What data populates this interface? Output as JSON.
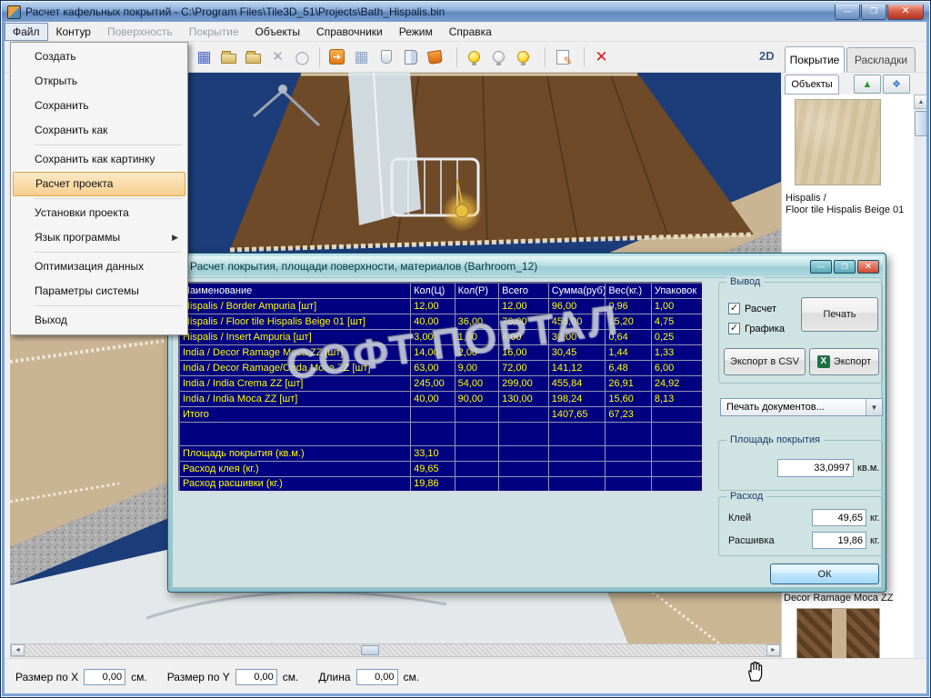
{
  "window": {
    "title": "Расчет кафельных покрытий - C:\\Program Files\\Tile3D_51\\Projects\\Bath_Hispalis.bin"
  },
  "menubar": {
    "file": "Файл",
    "contour": "Контур",
    "surface": "Поверхность",
    "covering": "Покрытие",
    "objects": "Объекты",
    "catalogs": "Справочники",
    "mode": "Режим",
    "help": "Справка"
  },
  "file_menu": {
    "new": "Создать",
    "open": "Открыть",
    "save": "Сохранить",
    "save_as": "Сохранить как",
    "save_as_picture": "Сохранить как картинку",
    "project_calc": "Расчет проекта",
    "project_settings": "Установки проекта",
    "language": "Язык программы",
    "data_optimization": "Оптимизация данных",
    "system_params": "Параметры системы",
    "exit": "Выход"
  },
  "toolbar": {
    "label_2d": "2D"
  },
  "right_panel": {
    "tab_covering": "Покрытие",
    "tab_layouts": "Раскладки",
    "tab_objects": "Объекты",
    "thumb1_line1": "Hispalis /",
    "thumb1_line2": "Floor tile Hispalis Beige 01",
    "thumb2_label": "Decor Ramage Moca ZZ"
  },
  "dialog": {
    "title": "Расчет покрытия, площади поверхности, материалов (Barhroom_12)",
    "table": {
      "headers": [
        "Наименование",
        "Кол(Ц)",
        "Кол(Р)",
        "Всего",
        "Сумма(руб)",
        "Вес(кг.)",
        "Упаковок"
      ],
      "rows": [
        [
          "Hispalis / Border Ampuria [шт]",
          "12,00",
          "",
          "12,00",
          "96,00",
          "0,96",
          "1,00"
        ],
        [
          "Hispalis / Floor tile Hispalis Beige 01 [шт]",
          "40,00",
          "36,00",
          "76,00",
          "456,00",
          "15,20",
          "4,75"
        ],
        [
          "Hispalis / Insert Ampuria [шт]",
          "3,00",
          "1,00",
          "4,00",
          "30,00",
          "0,64",
          "0,25"
        ],
        [
          "India / Decor Ramage Moca ZZ [шт]",
          "14,00",
          "2,00",
          "16,00",
          "30,45",
          "1,44",
          "1,33"
        ],
        [
          "India / Decor Ramage/Onda Moca ZZ [шт]",
          "63,00",
          "9,00",
          "72,00",
          "141,12",
          "6,48",
          "6,00"
        ],
        [
          "India / India Crema ZZ [шт]",
          "245,00",
          "54,00",
          "299,00",
          "455,84",
          "26,91",
          "24,92"
        ],
        [
          "India / India Moca ZZ [шт]",
          "40,00",
          "90,00",
          "130,00",
          "198,24",
          "15,60",
          "8,13"
        ],
        [
          "Итого",
          "",
          "",
          "",
          "1407,65",
          "67,23",
          ""
        ],
        [
          "",
          "",
          "",
          "",
          "",
          "",
          ""
        ],
        [
          "Площадь покрытия (кв.м.)",
          "33,10",
          "",
          "",
          "",
          "",
          ""
        ],
        [
          "Расход клея (кг.)",
          "49,65",
          "",
          "",
          "",
          "",
          ""
        ],
        [
          "Расход расшивки (кг.)",
          "19,86",
          "",
          "",
          "",
          "",
          ""
        ]
      ]
    },
    "output_group": "Вывод",
    "chk_calc": "Расчет",
    "chk_graphics": "Графика",
    "btn_print": "Печать",
    "btn_export_csv": "Экспорт в CSV",
    "btn_export": "Экспорт",
    "combo_print_docs": "Печать документов...",
    "area_group": "Площадь покрытия",
    "area_value": "33,0997",
    "area_unit": "кв.м.",
    "consumption_group": "Расход",
    "glue_label": "Клей",
    "glue_value": "49,65",
    "glue_unit": "кг.",
    "grout_label": "Расшивка",
    "grout_value": "19,86",
    "grout_unit": "кг.",
    "btn_ok": "ОК"
  },
  "statusbar": {
    "size_x_label": "Размер по X",
    "size_x_value": "0,00",
    "unit1": "см.",
    "size_y_label": "Размер по Y",
    "size_y_value": "0,00",
    "unit2": "см.",
    "length_label": "Длина",
    "length_value": "0,00",
    "unit3": "см."
  },
  "watermark": "СОФТ ПОРТАЛ"
}
